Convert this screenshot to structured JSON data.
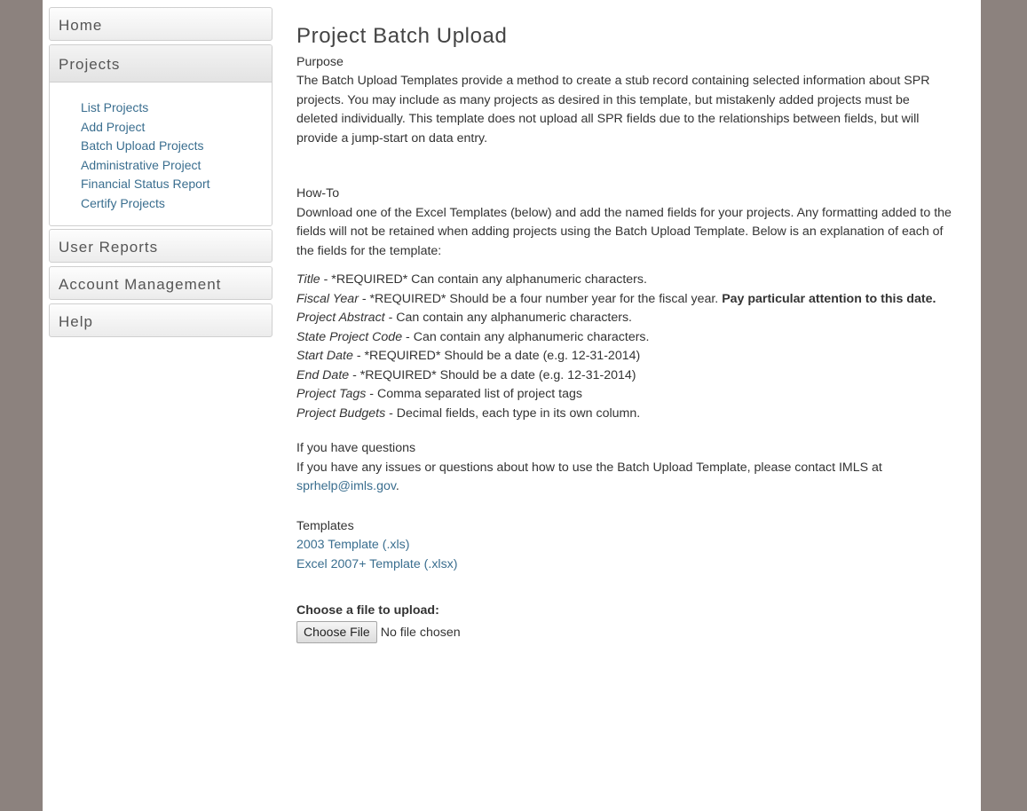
{
  "sidebar": {
    "home": "Home",
    "projects": {
      "label": "Projects",
      "items": [
        "List Projects",
        "Add Project",
        "Batch Upload Projects",
        "Administrative Project",
        "Financial Status Report",
        "Certify Projects"
      ]
    },
    "user_reports": "User Reports",
    "account_management": "Account Management",
    "help": "Help"
  },
  "main": {
    "title": "Project Batch Upload",
    "purpose": {
      "heading": "Purpose",
      "text": "The Batch Upload Templates provide a method to create a stub record containing selected information about SPR projects. You may include as many projects as desired in this template, but mistakenly added projects must be deleted individually. This template does not upload all SPR fields due to the relationships between fields, but will provide a jump-start on data entry."
    },
    "howto": {
      "heading": "How-To",
      "text": "Download one of the Excel Templates (below) and add the named fields for your projects. Any formatting added to the fields will not be retained when adding projects using the Batch Upload Template. Below is an explanation of each of the fields for the template:"
    },
    "fields": [
      {
        "name": "Title",
        "desc": " - *REQUIRED* Can contain any alphanumeric characters.",
        "bold": ""
      },
      {
        "name": "Fiscal Year",
        "desc": " - *REQUIRED* Should be a four number year for the fiscal year. ",
        "bold": "Pay particular attention to this date."
      },
      {
        "name": "Project Abstract",
        "desc": " - Can contain any alphanumeric characters.",
        "bold": ""
      },
      {
        "name": "State Project Code",
        "desc": " - Can contain any alphanumeric characters.",
        "bold": ""
      },
      {
        "name": "Start Date",
        "desc": " - *REQUIRED* Should be a date (e.g. 12-31-2014)",
        "bold": ""
      },
      {
        "name": "End Date",
        "desc": " - *REQUIRED* Should be a date (e.g. 12-31-2014)",
        "bold": ""
      },
      {
        "name": "Project Tags",
        "desc": " - Comma separated list of project tags",
        "bold": ""
      },
      {
        "name": "Project Budgets",
        "desc": " - Decimal fields, each type in its own column.",
        "bold": ""
      }
    ],
    "questions": {
      "heading": "If you have questions",
      "text": "If you have any issues or questions about how to use the Batch Upload Template, please contact IMLS at ",
      "email": "sprhelp@imls.gov",
      "suffix": "."
    },
    "templates": {
      "heading": "Templates",
      "t2003": "2003 Template (.xls)",
      "t2007": "Excel 2007+ Template (.xlsx)"
    },
    "upload": {
      "label": "Choose a file to upload:",
      "button": "Choose File",
      "status": "No file chosen"
    }
  }
}
